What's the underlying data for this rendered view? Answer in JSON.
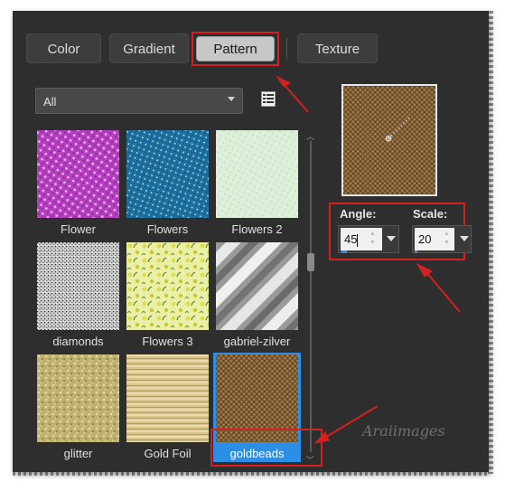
{
  "tabs": [
    {
      "label": "Color",
      "active": false
    },
    {
      "label": "Gradient",
      "active": false
    },
    {
      "label": "Pattern",
      "active": true
    },
    {
      "label": "Texture",
      "active": false
    }
  ],
  "filter": {
    "selected": "All"
  },
  "patterns": [
    {
      "label": "Flower",
      "selected": false
    },
    {
      "label": "Flowers",
      "selected": false
    },
    {
      "label": "Flowers 2",
      "selected": false
    },
    {
      "label": "diamonds",
      "selected": false
    },
    {
      "label": "Flowers 3",
      "selected": false
    },
    {
      "label": "gabriel-zilver",
      "selected": false
    },
    {
      "label": "glitter",
      "selected": false
    },
    {
      "label": "Gold Foil",
      "selected": false
    },
    {
      "label": "goldbeads",
      "selected": true
    }
  ],
  "angle": {
    "label": "Angle:",
    "value": "45"
  },
  "scale": {
    "label": "Scale:",
    "value": "20"
  },
  "watermark": "Araiimages",
  "colors": {
    "accent": "#2d8ee6",
    "highlight": "#d61f1f",
    "panel": "#2e2e2e"
  }
}
